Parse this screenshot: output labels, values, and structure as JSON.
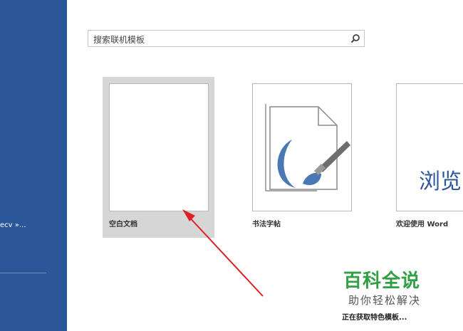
{
  "sidebar": {
    "recent_link": "ecv »..."
  },
  "search": {
    "placeholder": "搜索联机模板",
    "icon": "search-icon"
  },
  "templates": [
    {
      "label": "空白文档"
    },
    {
      "label": "书法字帖"
    },
    {
      "label": "欢迎使用 Word",
      "thumb_text": "浏览"
    }
  ],
  "status": {
    "text": "正在获取特色模板..."
  },
  "watermark": {
    "title": "百科全说",
    "subtitle": "助你轻松解决"
  },
  "colors": {
    "sidebar": "#2b579a",
    "accent_blue": "#2b579a",
    "arrow": "#e02020",
    "watermark_green": "#31a043"
  }
}
